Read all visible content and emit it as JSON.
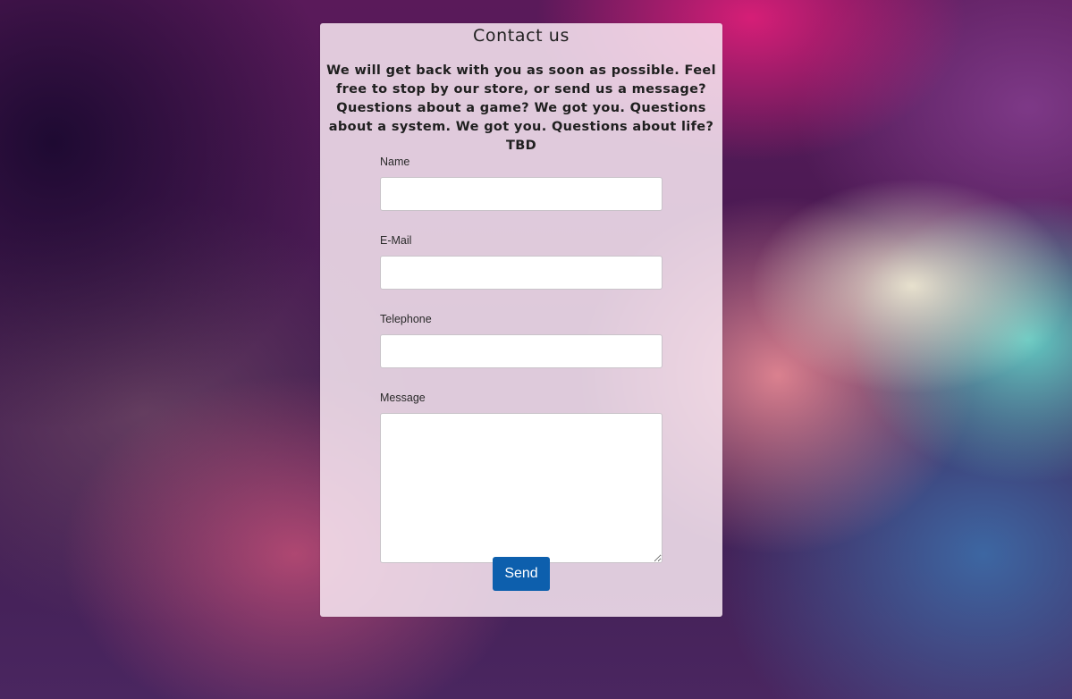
{
  "contact": {
    "title": "Contact us",
    "intro": "We will get back with you as soon as possible.  Feel free to stop by our store, or send us a message? Questions about a game? We got you. Questions about a system. We got you. Questions about life? TBD"
  },
  "form": {
    "name_label": "Name",
    "name_value": "",
    "email_label": "E-Mail",
    "email_value": "",
    "phone_label": "Telephone",
    "phone_value": "",
    "message_label": "Message",
    "message_value": "",
    "send_label": "Send"
  },
  "colors": {
    "button_bg": "#0d5fad",
    "button_text": "#ffffff",
    "card_bg": "#f8e8f2"
  }
}
